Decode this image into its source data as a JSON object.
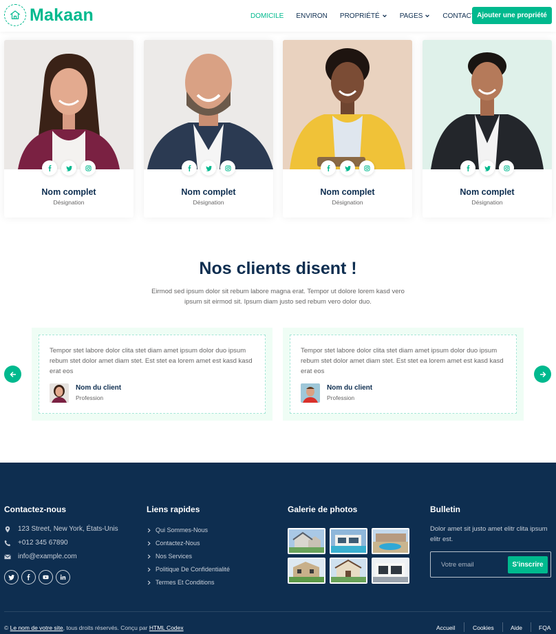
{
  "brand": {
    "name": "Makaan",
    "accent": "#00b98e",
    "dark": "#0e2e50"
  },
  "nav": {
    "items": [
      {
        "label": "Domicile",
        "active": true,
        "dropdown": false
      },
      {
        "label": "Environ",
        "active": false,
        "dropdown": false
      },
      {
        "label": "Propriété",
        "active": false,
        "dropdown": true
      },
      {
        "label": "Pages",
        "active": false,
        "dropdown": true
      },
      {
        "label": "Contact",
        "active": false,
        "dropdown": false
      }
    ],
    "cta": "Ajouter une propriété"
  },
  "team": {
    "members": [
      {
        "name": "Nom complet",
        "role": "Désignation",
        "socials": [
          "facebook-icon",
          "twitter-icon",
          "instagram-icon"
        ]
      },
      {
        "name": "Nom complet",
        "role": "Désignation",
        "socials": [
          "facebook-icon",
          "twitter-icon",
          "instagram-icon"
        ]
      },
      {
        "name": "Nom complet",
        "role": "Désignation",
        "socials": [
          "facebook-icon",
          "twitter-icon",
          "instagram-icon"
        ]
      },
      {
        "name": "Nom complet",
        "role": "Désignation",
        "socials": [
          "facebook-icon",
          "twitter-icon",
          "instagram-icon"
        ]
      }
    ]
  },
  "testimonials": {
    "title": "Nos clients disent !",
    "subtitle": "Eirmod sed ipsum dolor sit rebum labore magna erat. Tempor ut dolore lorem kasd vero ipsum sit eirmod sit. Ipsum diam justo sed rebum vero dolor duo.",
    "items": [
      {
        "text": "Tempor stet labore dolor clita stet diam amet ipsum dolor duo ipsum rebum stet dolor amet diam stet. Est stet ea lorem amet est kasd kasd erat eos",
        "name": "Nom du client",
        "profession": "Profession"
      },
      {
        "text": "Tempor stet labore dolor clita stet diam amet ipsum dolor duo ipsum rebum stet dolor amet diam stet. Est stet ea lorem amet est kasd kasd erat eos",
        "name": "Nom du client",
        "profession": "Profession"
      }
    ]
  },
  "footer": {
    "contact": {
      "title": "Contactez-nous",
      "address": "123 Street, New York, États-Unis",
      "phone": "+012 345 67890",
      "email": "info@example.com"
    },
    "quick_links": {
      "title": "Liens rapides",
      "items": [
        "Qui Sommes-Nous",
        "Contactez-Nous",
        "Nos Services",
        "Politique De Confidentialité",
        "Termes Et Conditions"
      ]
    },
    "gallery": {
      "title": "Galerie de photos"
    },
    "newsletter": {
      "title": "Bulletin",
      "text": "Dolor amet sit justo amet elitr clita ipsum elitr est.",
      "placeholder": "Votre email",
      "button": "S'inscrire"
    },
    "copyright": {
      "prefix": "©",
      "site": "Le nom de votre site",
      "middle": ", tous droits réservés. Conçu par",
      "designer": "HTML Codex"
    },
    "menu": [
      "Accueil",
      "Cookies",
      "Aide",
      "FQA"
    ]
  }
}
